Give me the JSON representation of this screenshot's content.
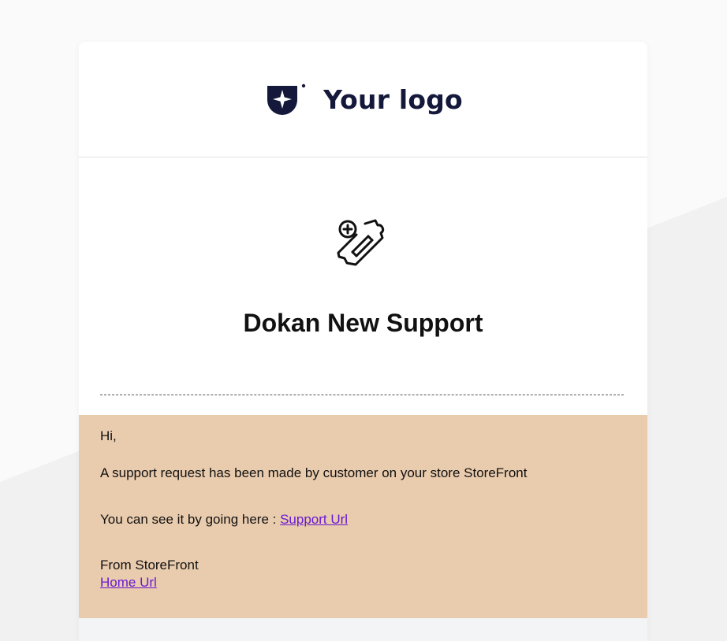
{
  "email": {
    "logo_text": "Your logo",
    "logo_icon": "shield-star-icon",
    "hero_icon": "ticket-add-icon",
    "title": "Dokan New Support",
    "greeting": "Hi,",
    "request_text": "A support request has been made by customer on your store StoreFront",
    "see_prefix": "You can see it by going here : ",
    "support_link": "Support Url",
    "from_text": "From StoreFront",
    "home_link": "Home Url"
  },
  "colors": {
    "message_bg": "#e9cbad",
    "link": "#6a1bd1",
    "logo": "#14183a"
  }
}
